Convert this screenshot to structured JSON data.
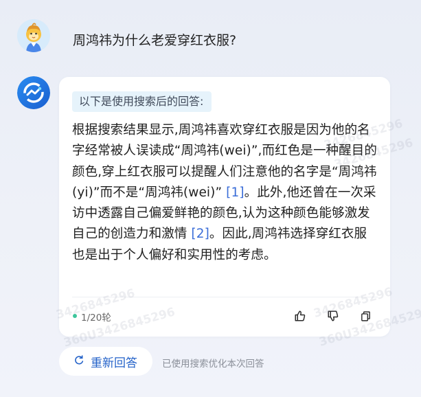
{
  "user": {
    "question": "周鸿祎为什么老爱穿红衣服?"
  },
  "answer": {
    "search_tag": "以下是使用搜索后的回答:",
    "text_1": "根据搜索结果显示,周鸿祎喜欢穿红衣服是因为他的名字经常被人误读成“周鸿祎(wei)”,而红色是一种醒目的颜色,穿上红衣服可以提醒人们注意他的名字是“周鸿祎(yi)”而不是“周鸿祎(wei)”",
    "cite_1": "[1]",
    "text_2": "。此外,他还曾在一次采访中透露自己偏爱鲜艳的颜色,认为这种颜色能够激发自己的创造力和激情",
    "cite_2": "[2]",
    "text_3": "。因此,周鸿祎选择穿红衣服也是出于个人偏好和实用性的考虑。",
    "round_count": "1/20轮",
    "icons": {
      "like": "thumbs-up-icon",
      "dislike": "thumbs-down-icon",
      "copy": "copy-icon"
    }
  },
  "footer": {
    "regenerate_label": "重新回答",
    "note": "已使用搜索优化本次回答"
  },
  "watermarks": {
    "wm_1": "3426845296",
    "wm_2": "3426845296",
    "wm_3": "3426845296",
    "wm_4": "360U3426845296",
    "wm_5": "3426845296",
    "wm_6": "360U3426845296"
  },
  "colors": {
    "accent_blue": "#2563c9",
    "citation_blue": "#3b6ed8",
    "status_green": "#3cc59b",
    "tag_background": "#e6f3fb"
  }
}
